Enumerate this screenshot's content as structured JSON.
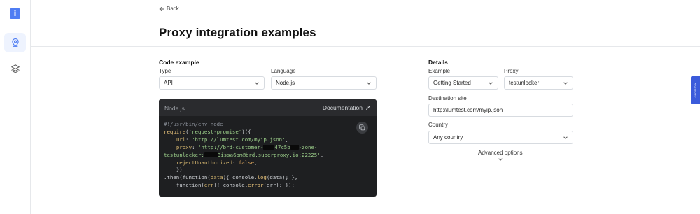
{
  "sidebar": {
    "logo_glyph": "i",
    "items": [
      {
        "icon": "location-pin-icon",
        "active": true
      },
      {
        "icon": "layers-icon",
        "active": false
      }
    ]
  },
  "header": {
    "back_label": "Back",
    "title": "Proxy integration examples"
  },
  "code_example": {
    "section_title": "Code example",
    "type_label": "Type",
    "type_value": "API",
    "language_label": "Language",
    "language_value": "Node.js"
  },
  "code_panel": {
    "lang": "Node.js",
    "documentation_label": "Documentation",
    "lines": {
      "l1": "#!/usr/bin/env node",
      "l2_fn": "require",
      "l2_open": "(",
      "l2_str": "'request-promise'",
      "l2_close": ")({",
      "l3_key": "url",
      "l3_str": "'http://lumtest.com/myip.json'",
      "l4_key": "proxy",
      "l4_str_a": "'http://brd-customer-",
      "l4_str_b": "47c5b",
      "l4_str_c": "-zone-",
      "l5_str_a": "testunlocker:",
      "l5_str_b": "3issa6pm@brd.superproxy.io:22225'",
      "l6_key": "rejectUnauthorized",
      "l6_val": "false",
      "l7": "})",
      "l8_a": ".then(function(",
      "l8_b": "data",
      "l8_c": "){ console.",
      "l8_d": "log",
      "l8_e": "(data); },",
      "l9_a": "function(",
      "l9_b": "err",
      "l9_c": "){ console.",
      "l9_d": "error",
      "l9_e": "(err); });"
    }
  },
  "details": {
    "section_title": "Details",
    "example_label": "Example",
    "example_value": "Getting Started",
    "proxy_label": "Proxy",
    "proxy_value": "testunlocker",
    "destination_label": "Destination site",
    "destination_value": "http://lumtest.com/myip.json",
    "country_label": "Country",
    "country_value": "Any country",
    "advanced_label": "Advanced options"
  },
  "feedback_tab_label": "Accessibility",
  "colors": {
    "accent": "#4f7df3",
    "code_bg": "#1e1f21",
    "feedback_tab": "#3b5bdb"
  }
}
